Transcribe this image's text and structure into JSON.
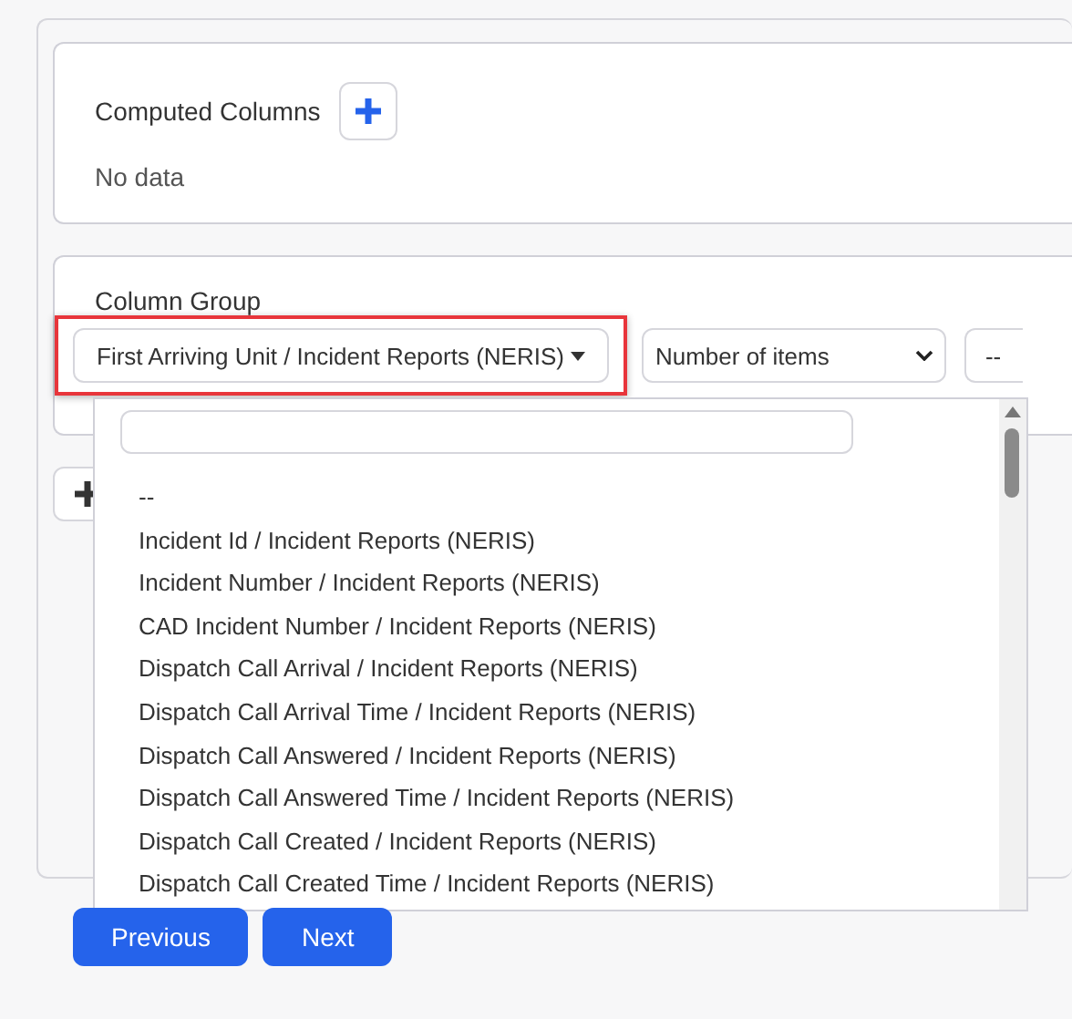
{
  "computed_columns": {
    "title": "Computed Columns",
    "empty_text": "No data"
  },
  "column_group": {
    "label": "Column Group",
    "field_select": {
      "value": "First Arriving Unit / Incident Reports (NERIS)",
      "expanded": true,
      "highlighted": true
    },
    "aggregate_select": {
      "value": "Number of items"
    },
    "third_select": {
      "value": "--"
    }
  },
  "dropdown": {
    "options": [
      {
        "label": "--"
      },
      {
        "label": "Incident Id / Incident Reports (NERIS)"
      },
      {
        "label": "Incident Number / Incident Reports (NERIS)"
      },
      {
        "label": "CAD Incident Number / Incident Reports (NERIS)"
      },
      {
        "label": "Dispatch Call Arrival / Incident Reports (NERIS)"
      },
      {
        "label": "Dispatch Call Arrival Time / Incident Reports (NERIS)"
      },
      {
        "label": "Dispatch Call Answered / Incident Reports (NERIS)"
      },
      {
        "label": "Dispatch Call Answered Time / Incident Reports (NERIS)"
      },
      {
        "label": "Dispatch Call Created / Incident Reports (NERIS)"
      },
      {
        "label": "Dispatch Call Created Time / Incident Reports (NERIS)"
      }
    ]
  },
  "buttons": [
    {
      "label": "Previous"
    },
    {
      "label": "Next"
    }
  ]
}
